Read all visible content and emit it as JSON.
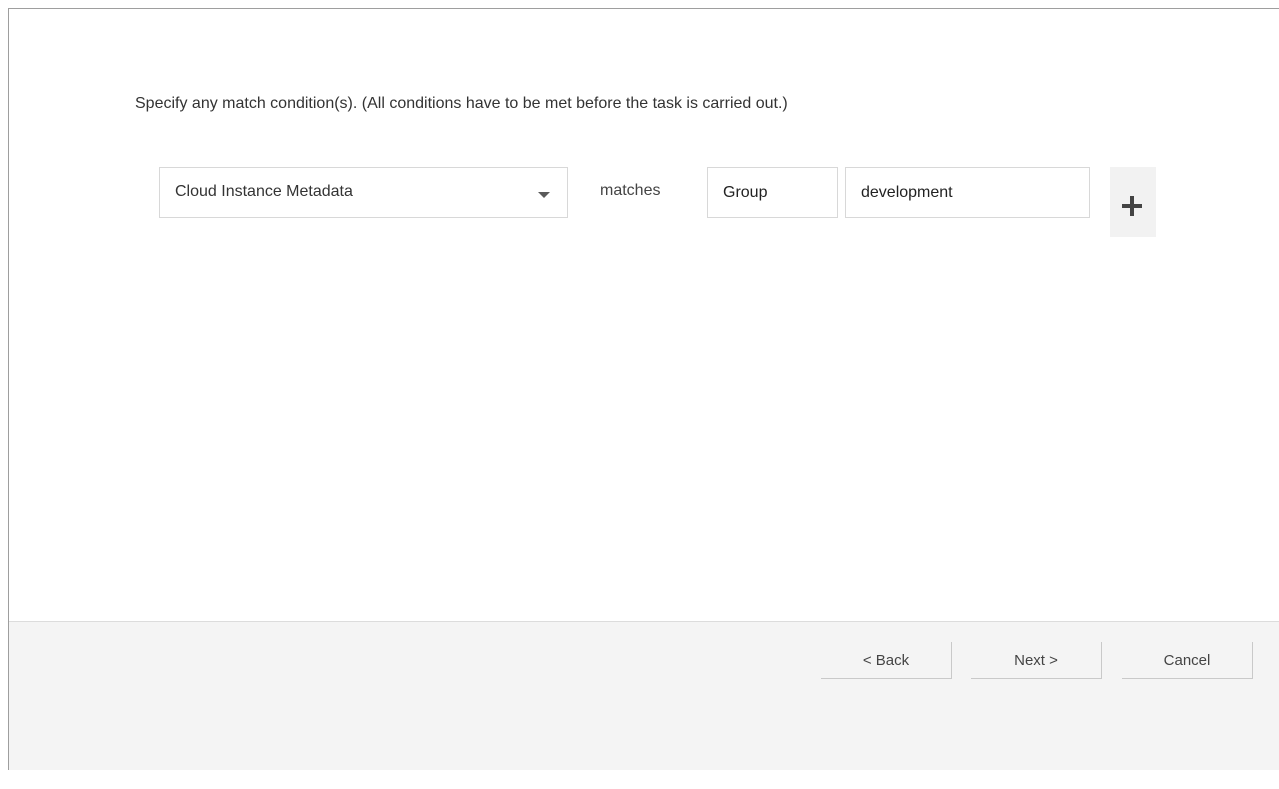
{
  "instruction": "Specify any match condition(s). (All conditions have to be met before the task is carried out.)",
  "condition": {
    "field_select": {
      "selected": "Cloud Instance Metadata"
    },
    "operator": "matches",
    "key_value": "Group",
    "value_value": "development",
    "add_icon": "plus-icon"
  },
  "footer": {
    "back_label": "< Back",
    "next_label": "Next >",
    "cancel_label": "Cancel"
  }
}
